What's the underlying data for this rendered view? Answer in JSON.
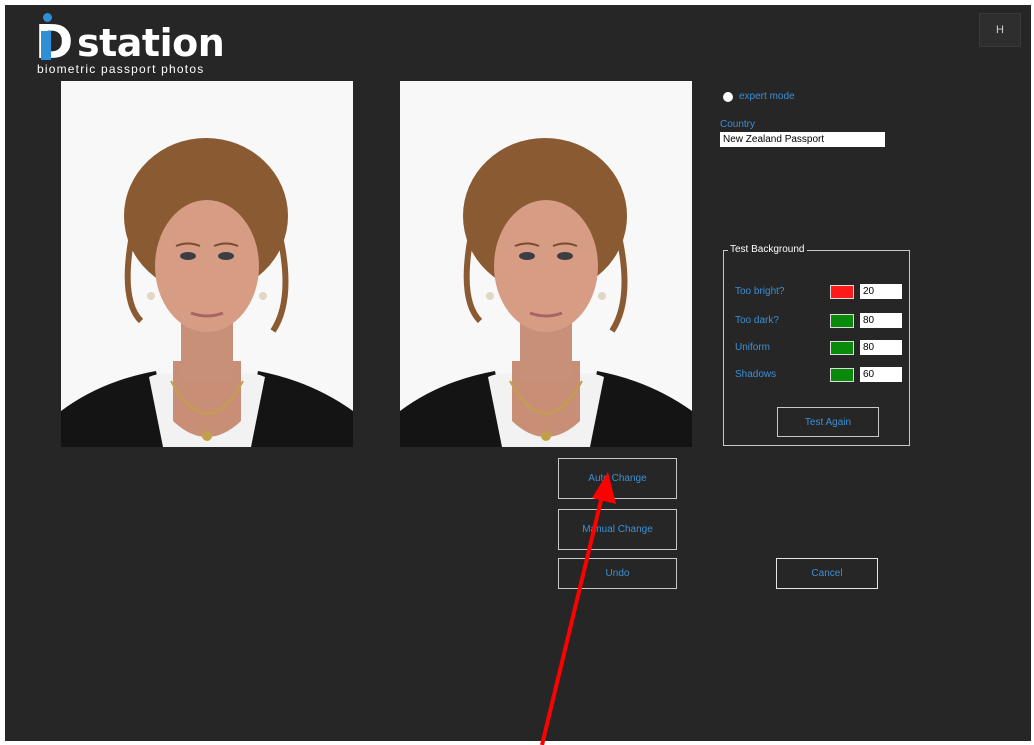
{
  "brand": {
    "word": "station",
    "letter": "D",
    "tagline": "biometric passport photos"
  },
  "header": {
    "help_label": "H"
  },
  "expert_mode": {
    "label": "expert mode"
  },
  "country": {
    "label": "Country",
    "value": "New Zealand Passport"
  },
  "test_background": {
    "title": "Test Background",
    "rows": [
      {
        "label": "Too bright?",
        "status_color": "#ff1a1a",
        "value": "20"
      },
      {
        "label": "Too dark?",
        "status_color": "#0a8a0a",
        "value": "80"
      },
      {
        "label": "Uniform",
        "status_color": "#0a8a0a",
        "value": "80"
      },
      {
        "label": "Shadows",
        "status_color": "#0a8a0a",
        "value": "60"
      }
    ],
    "test_again_label": "Test Again"
  },
  "actions": {
    "auto_change": "Auto Change",
    "manual_change": "Manual Change",
    "undo": "Undo",
    "cancel": "Cancel"
  },
  "colors": {
    "app_background": "#262626",
    "accent_text": "#3b8fd6",
    "annotation_arrow": "#ff0000"
  }
}
